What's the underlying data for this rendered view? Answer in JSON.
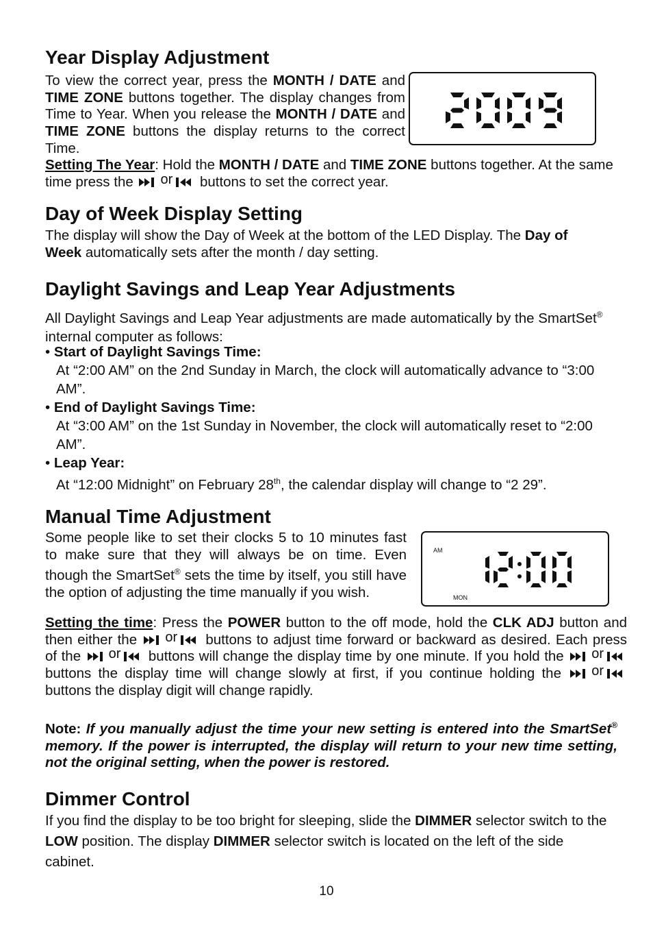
{
  "sections": {
    "year": {
      "heading": "Year Display Adjustment",
      "intro": {
        "t1": "To view the correct year, press the ",
        "b1": "MONTH / DATE",
        "t2": " and ",
        "b2": "TIME ZONE",
        "t3": " buttons together.  The display changes from Time to Year. When you release the ",
        "b3": "MONTH / DATE",
        "t4": " and ",
        "b4": "TIME ZONE",
        "t5": " buttons the display returns to the correct Time."
      },
      "setting": {
        "label": "Setting The Year",
        "t1": ": Hold the ",
        "b1": "MONTH / DATE",
        "t2": " and ",
        "b2": "TIME ZONE",
        "t3": " buttons together. At the same time press the ",
        "or": "or",
        "t4": " buttons to set the correct year."
      },
      "display": {
        "digits": "2009"
      }
    },
    "dow": {
      "heading": "Day of Week Display Setting",
      "t1": "The display will show the Day of Week at the bottom of the LED Display. The ",
      "b1": "Day of Week",
      "t2": " automatically sets after the month / day setting."
    },
    "dst": {
      "heading": "Daylight Savings and Leap Year Adjustments",
      "intro_a": "All Daylight Savings and Leap Year adjustments are made automatically by the SmartSet",
      "reg": "®",
      "intro_b": " internal computer as follows:",
      "bullet": "•",
      "items": [
        {
          "title": "Start of Daylight Savings Time:",
          "text": "At “2:00 AM” on the 2nd Sunday in March, the clock will automatically advance to “3:00 AM”."
        },
        {
          "title": "End of Daylight Savings Time:",
          "text": "At “3:00 AM” on the 1st Sunday in November, the clock will automatically reset to “2:00 AM”."
        },
        {
          "title": "Leap Year:",
          "text_a": "At “12:00 Midnight” on February 28",
          "sup": "th",
          "text_b": ", the calendar display will change to “2 29”."
        }
      ]
    },
    "manual": {
      "heading": "Manual Time Adjustment",
      "intro_a": "Some people like to set their clocks 5 to 10 minutes fast to make sure that they will always be on time. Even though the SmartSet",
      "reg": "®",
      "intro_b": " sets the time by itself, you still have the option of adjusting the time manually if you wish.",
      "display": {
        "time": "12:00",
        "ampm": "AM",
        "day": "MON"
      },
      "setting": {
        "label": "Setting the time",
        "t1": ": Press the ",
        "b1": "POWER",
        "t2": " button to the off mode, hold the ",
        "b2": "CLK ADJ",
        "t3": " button and then either the ",
        "or": "or",
        "t4": " buttons to adjust time forward or backward as desired. Each press of the ",
        "t5": " buttons will change the display time by one minute. If you hold the ",
        "t6": " buttons the display time will change slowly at first, if you continue holding the ",
        "t7": " buttons the display digit will change rapidly."
      },
      "note": {
        "label": "Note:",
        "text_a": " If you manually adjust the time your new setting is entered into the SmartSet",
        "reg": "®",
        "text_b": " memory. If the power is interrupted, the display will return to your new time setting, not the original setting, when the power is restored."
      }
    },
    "dimmer": {
      "heading": "Dimmer Control",
      "t1": "If you find the display to be too bright for sleeping, slide the ",
      "b1": "DIMMER",
      "t2": " selector switch to the ",
      "b2": "LOW",
      "t3": " position.  The display ",
      "b3": "DIMMER",
      "t4": " selector switch is located on the left of the side cabinet."
    }
  },
  "icons": {
    "forward": "skip-forward-icon",
    "backward": "skip-backward-icon"
  },
  "page_number": "10"
}
